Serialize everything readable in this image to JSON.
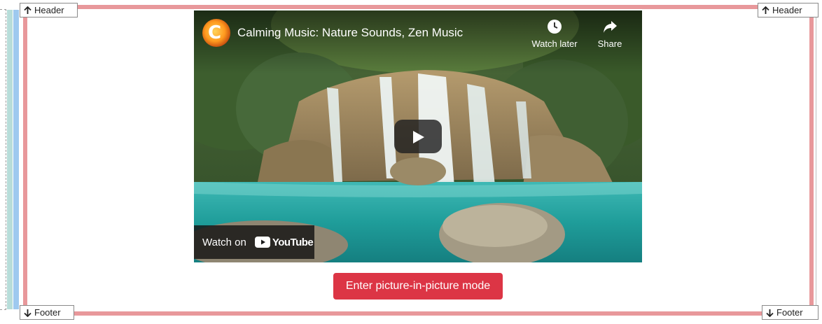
{
  "edge_buttons": {
    "header_left": "Header",
    "header_right": "Header",
    "footer_left": "Footer",
    "footer_right": "Footer"
  },
  "video": {
    "title": "Calming Music: Nature Sounds, Zen Music",
    "channel_avatar_icon": "channel-logo-icon",
    "watch_later_label": "Watch later",
    "share_label": "Share",
    "watch_on_label": "Watch on",
    "youtube_logo_text": "YouTube"
  },
  "pip_button": {
    "label": "Enter picture-in-picture mode"
  },
  "colors": {
    "frame": "#e8989b",
    "teal_strip": "#b7ddd9",
    "blue_strip": "#9ec9ef",
    "pip_button": "#dc3545"
  }
}
